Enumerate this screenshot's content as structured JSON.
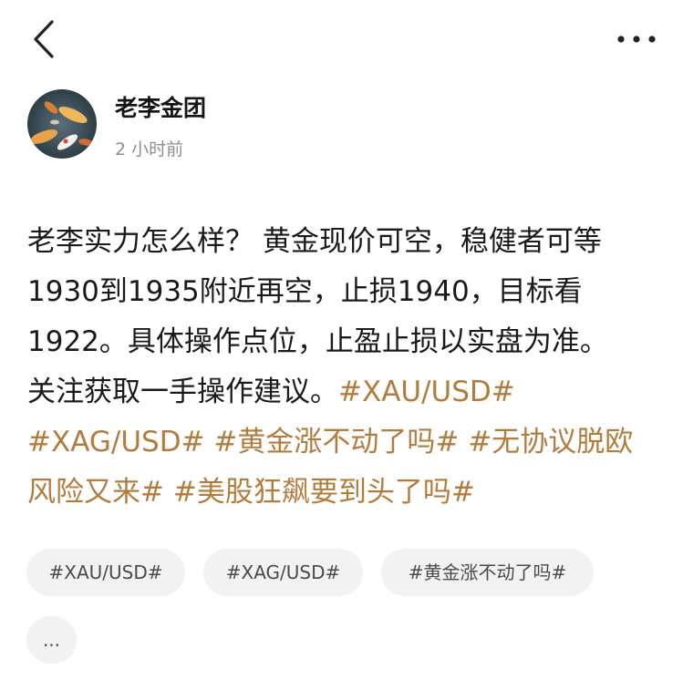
{
  "nav": {
    "back_icon": "chevron-left-icon",
    "more_icon": "more-horizontal-icon"
  },
  "author": {
    "name": "老李金团",
    "time": "2 小时前",
    "avatar_icon": "koi-fish-avatar"
  },
  "post": {
    "lines": [
      [
        {
          "text": "老李实力怎么样？ 黄金现价可空，稳健者可等",
          "tag": false
        }
      ],
      [
        {
          "text": "1930到1935附近再空，止损1940，目标看",
          "tag": false
        }
      ],
      [
        {
          "text": "1922。具体操作点位，止盈止损以实盘为准。",
          "tag": false
        }
      ],
      [
        {
          "text": "关注获取一手操作建议。",
          "tag": false
        },
        {
          "text": "#XAU/USD#",
          "tag": true
        }
      ],
      [
        {
          "text": "#XAG/USD#",
          "tag": true
        },
        {
          "text": " ",
          "tag": false
        },
        {
          "text": "#黄金涨不动了吗#",
          "tag": true
        },
        {
          "text": " ",
          "tag": false
        },
        {
          "text": "#无协议脱欧",
          "tag": true
        }
      ],
      [
        {
          "text": "风险又来#",
          "tag": true
        },
        {
          "text": " ",
          "tag": false
        },
        {
          "text": "#美股狂飙要到头了吗#",
          "tag": true
        }
      ]
    ]
  },
  "tag_chips": [
    "#XAU/USD#",
    "#XAG/USD#",
    "#黄金涨不动了吗#",
    "..."
  ],
  "colors": {
    "hashtag": "#b47c3c",
    "chip_bg": "#f2f2f2",
    "secondary_text": "#8e8e8e"
  }
}
